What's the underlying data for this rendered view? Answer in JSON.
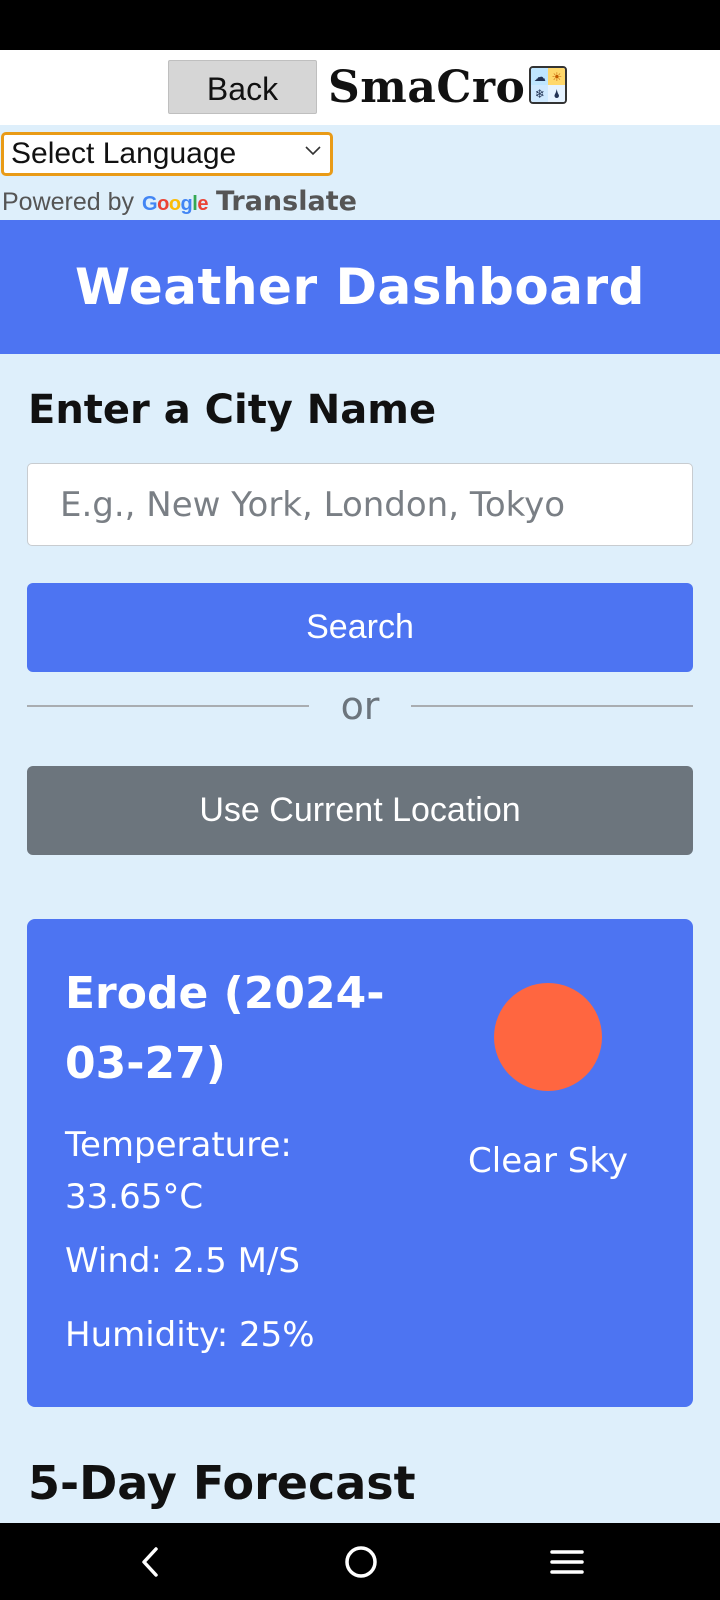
{
  "header": {
    "back_label": "Back",
    "brand": "SmaCro",
    "logo_icon": "weather-grid-logo"
  },
  "translate": {
    "select_label": "Select Language",
    "powered_by": "Powered by",
    "google_letters": [
      "G",
      "o",
      "o",
      "g",
      "l",
      "e"
    ],
    "translate_word": "Translate"
  },
  "dashboard": {
    "title": "Weather Dashboard",
    "city_label": "Enter a City Name",
    "city_placeholder": "E.g., New York, London, Tokyo",
    "search_label": "Search",
    "or_label": "or",
    "location_label": "Use Current Location"
  },
  "current_weather": {
    "title": "Erode (2024-03-27)",
    "temperature": "Temperature: 33.65°C",
    "wind": "Wind: 2.5 M/S",
    "humidity": "Humidity: 25%",
    "description": "Clear Sky",
    "icon": "sun-icon"
  },
  "forecast": {
    "title": "5-Day Forecast"
  },
  "colors": {
    "primary": "#4d74f2",
    "secondary": "#6c757d",
    "page_bg": "#deeffb",
    "sun": "#ff6640",
    "select_border": "#e99b17"
  },
  "system_nav": {
    "back_icon": "back-chevron-icon",
    "home_icon": "home-circle-icon",
    "recents_icon": "recents-menu-icon"
  }
}
